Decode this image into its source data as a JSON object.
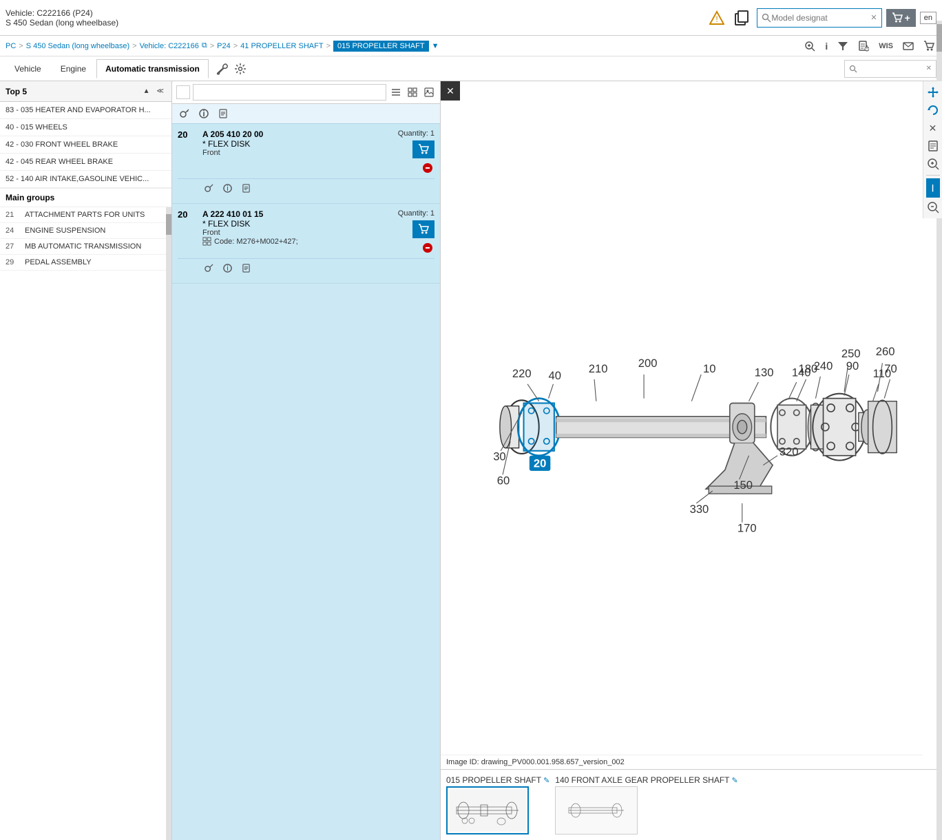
{
  "header": {
    "vehicle_id": "Vehicle: C222166 (P24)",
    "vehicle_name": "S 450 Sedan (long wheelbase)",
    "lang": "en",
    "search_placeholder": "Model designat",
    "alert_icon": "alert-icon",
    "copy_icon": "copy-icon",
    "cart_icon": "cart-icon"
  },
  "breadcrumb": {
    "items": [
      "PC",
      "S 450 Sedan (long wheelbase)",
      "Vehicle: C222166",
      "P24",
      "41 PROPELLER SHAFT",
      "015 PROPELLER SHAFT"
    ],
    "active": "015 PROPELLER SHAFT",
    "right_icons": [
      "zoom-plus-icon",
      "info-icon",
      "filter-icon",
      "doc-icon",
      "wis-icon",
      "mail-icon",
      "cart-icon"
    ]
  },
  "tabs": {
    "items": [
      {
        "label": "Vehicle",
        "active": false
      },
      {
        "label": "Engine",
        "active": false
      },
      {
        "label": "Automatic transmission",
        "active": true
      }
    ],
    "tab_icons": [
      "wrench-icon",
      "settings-icon"
    ],
    "search_placeholder": ""
  },
  "left_panel": {
    "top5_title": "Top 5",
    "items": [
      {
        "label": "83 - 035 HEATER AND EVAPORATOR H..."
      },
      {
        "label": "40 - 015 WHEELS"
      },
      {
        "label": "42 - 030 FRONT WHEEL BRAKE"
      },
      {
        "label": "42 - 045 REAR WHEEL BRAKE"
      },
      {
        "label": "52 - 140 AIR INTAKE,GASOLINE VEHIC..."
      }
    ],
    "main_groups_title": "Main groups",
    "groups": [
      {
        "num": "21",
        "label": "ATTACHMENT PARTS FOR UNITS"
      },
      {
        "num": "24",
        "label": "ENGINE SUSPENSION"
      },
      {
        "num": "27",
        "label": "MB AUTOMATIC TRANSMISSION"
      },
      {
        "num": "29",
        "label": "PEDAL ASSEMBLY"
      }
    ]
  },
  "parts_list": {
    "toolbar_icons": [
      "key-icon",
      "info-icon",
      "doc-icon"
    ],
    "items": [
      {
        "num": "20",
        "code": "A 205 410 20 00",
        "name": "* FLEX DISK",
        "location": "Front",
        "extra": "",
        "quantity": "1",
        "icons": [
          "key-icon",
          "info-icon",
          "doc-icon"
        ]
      },
      {
        "num": "20",
        "code": "A 222 410 01 15",
        "name": "* FLEX DISK",
        "location": "Front",
        "extra": "Code: M276+M002+427;",
        "quantity": "1",
        "icons": [
          "key-icon",
          "info-icon",
          "doc-icon"
        ]
      }
    ]
  },
  "diagram": {
    "image_id": "Image ID: drawing_PV000.001.958.657_version_002",
    "labels": [
      "10",
      "30",
      "40",
      "60",
      "70",
      "90",
      "110",
      "130",
      "140",
      "150",
      "170",
      "180",
      "200",
      "210",
      "220",
      "240",
      "250",
      "260",
      "320",
      "330"
    ],
    "highlighted": [
      "20"
    ]
  },
  "thumbnails": [
    {
      "label": "015 PROPELLER SHAFT",
      "active": true
    },
    {
      "label": "140 FRONT AXLE GEAR PROPELLER SHAFT",
      "active": false
    }
  ]
}
